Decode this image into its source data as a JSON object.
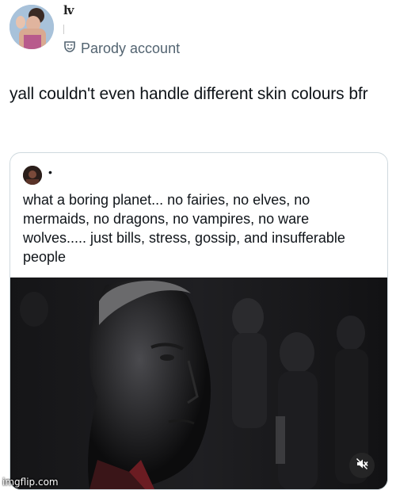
{
  "author": {
    "name": "lv",
    "badge": "Parody account",
    "badge_icon": "theater-mask-icon"
  },
  "tweet": {
    "text": "yall couldn't even handle different skin colours bfr"
  },
  "quoted": {
    "author_separator": "•",
    "text": "what a boring planet... no fairies, no elves, no mermaids, no dragons, no vampires, no ware wolves..... just bills, stress, gossip, and insufferable people"
  },
  "media": {
    "mute_icon": "mute-icon"
  },
  "watermark": "imgflip.com"
}
